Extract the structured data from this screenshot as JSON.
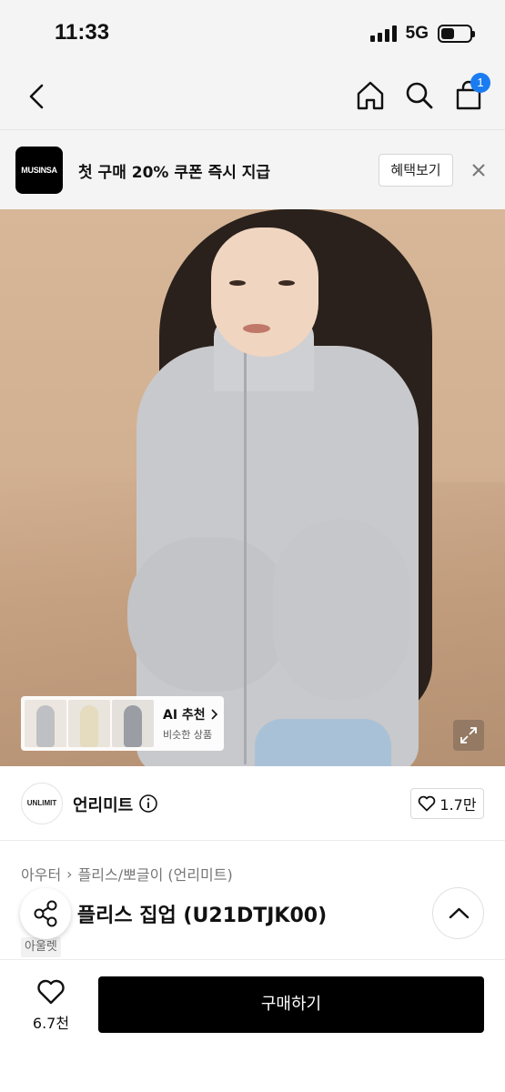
{
  "status_bar": {
    "time": "11:33",
    "network": "5G"
  },
  "nav": {
    "cart_count": "1"
  },
  "promo": {
    "logo_text": "MUSINSA",
    "message": "첫 구매 20% 쿠폰 즉시 지급",
    "button_label": "혜택보기"
  },
  "ai_recommend": {
    "title": "AI 추천",
    "subtitle": "비슷한 상품"
  },
  "brand": {
    "logo_text": "UNLIMIT",
    "name": "언리미트",
    "likes": "1.7만"
  },
  "product": {
    "breadcrumb": [
      "아우터",
      "플리스/뽀글이 (언리미트)"
    ],
    "title": "베이직 플리스 집업 (U21DTJK00)",
    "title_visible": "직 플리스 집업 (U21DTJK00)",
    "tag": "아울렛"
  },
  "bottom_bar": {
    "wish_count": "6.7천",
    "buy_label": "구매하기"
  },
  "colors": {
    "accent": "#1a7cf0",
    "buy_button": "#000000",
    "hero_bg": "#d2b092"
  }
}
